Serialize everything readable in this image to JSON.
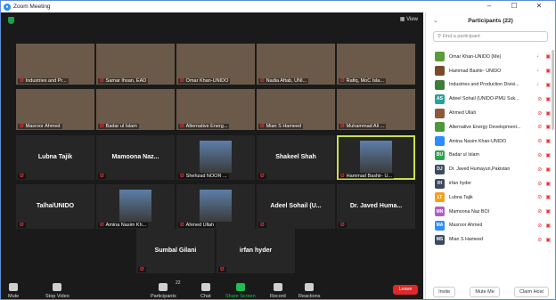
{
  "window": {
    "title": "Zoom Meeting",
    "min": "–",
    "max": "☐",
    "close": "✕"
  },
  "topbar": {
    "view_label": "View"
  },
  "tiles_video": [
    {
      "name": "Industries and Pr...",
      "muted": false
    },
    {
      "name": "Samar Ihsan, EAD",
      "muted": false
    },
    {
      "name": "Omar Khan-UNIDO",
      "muted": false
    },
    {
      "name": "Nadia Aftab, UNI...",
      "muted": false
    },
    {
      "name": "Rafiq, MoC Isla...",
      "muted": false
    },
    {
      "name": "Masroor Ahmed",
      "muted": true
    },
    {
      "name": "Badar ul Islam",
      "muted": true
    },
    {
      "name": "Alternative Energ...",
      "muted": true
    },
    {
      "name": "Mian S Hameed",
      "muted": true
    },
    {
      "name": "Muhammad Ali ...",
      "muted": true
    }
  ],
  "tiles_row3": [
    {
      "big": "Lubna Tajik",
      "name": ""
    },
    {
      "big": "Mamoona Naz...",
      "name": ""
    },
    {
      "big": "",
      "name": "Shehzad NOOR ..."
    },
    {
      "big": "Shakeel Shah",
      "name": ""
    },
    {
      "big": "",
      "name": "Hammad Bashir- U..."
    }
  ],
  "tiles_row4": [
    {
      "big": "Talha/UNIDO",
      "name": ""
    },
    {
      "big": "",
      "name": "Amina Nasim Kh..."
    },
    {
      "big": "",
      "name": "Ahmed Ullah"
    },
    {
      "big": "Adeel Sohail (U...",
      "name": ""
    },
    {
      "big": "Dr. Javed Huma...",
      "name": ""
    }
  ],
  "tiles_row5": [
    {
      "big": "Sumbal Gilani"
    },
    {
      "big": "irfan hyder"
    }
  ],
  "toolbar": {
    "mute": "Mute",
    "stop_video": "Stop Video",
    "participants": "Participants",
    "participants_count": "22",
    "chat": "Chat",
    "share_screen": "Share Screen",
    "record": "Record",
    "reactions": "Reactions",
    "leave": "Leave"
  },
  "panel": {
    "title": "Participants (22)",
    "search_placeholder": "Find a participant",
    "invite": "Invite",
    "mute_me": "Mute Me",
    "claim_host": "Claim Host",
    "participants": [
      {
        "name": "Omar Khan-UNIDO (Me)",
        "av": "",
        "color": "#5a9b3a",
        "mic": "on",
        "cam": "off"
      },
      {
        "name": "Hammad Bashir- UNIDO",
        "av": "",
        "color": "#7a4a2a",
        "mic": "on",
        "cam": "off"
      },
      {
        "name": "Industries and Production Divisi...",
        "av": "",
        "color": "#3f7d3a",
        "mic": "on",
        "cam": "off"
      },
      {
        "name": "Adeel Sohail (UNIDO-PMU Suk...",
        "av": "AS",
        "color": "#2aa198",
        "mic": "off",
        "cam": "off"
      },
      {
        "name": "Ahmed Ullah",
        "av": "",
        "color": "#8a5a3a",
        "mic": "off",
        "cam": "off"
      },
      {
        "name": "Alternative Energy Development...",
        "av": "",
        "color": "#4c9a3a",
        "mic": "off",
        "cam": "off"
      },
      {
        "name": "Amina Nasim Khan-UNIDO",
        "av": "",
        "color": "#2d8cff",
        "mic": "off",
        "cam": "off"
      },
      {
        "name": "Badar ul Islam",
        "av": "BU",
        "color": "#2da44e",
        "mic": "off",
        "cam": "off"
      },
      {
        "name": "Dr. Javed Humayun,Pakistan",
        "av": "DJ",
        "color": "#3d4a5c",
        "mic": "off",
        "cam": "off"
      },
      {
        "name": "irfan hyder",
        "av": "IH",
        "color": "#3d4a5c",
        "mic": "off",
        "cam": "off"
      },
      {
        "name": "Lubna Tajik",
        "av": "LT",
        "color": "#f0a020",
        "mic": "off",
        "cam": "off"
      },
      {
        "name": "Mamoona Naz BOI",
        "av": "MN",
        "color": "#b05cc7",
        "mic": "off",
        "cam": "off"
      },
      {
        "name": "Masroor Ahmed",
        "av": "MA",
        "color": "#2d8cff",
        "mic": "off",
        "cam": "off"
      },
      {
        "name": "Mian S Hameed",
        "av": "MS",
        "color": "#3d4a5c",
        "mic": "off",
        "cam": "off"
      }
    ]
  }
}
